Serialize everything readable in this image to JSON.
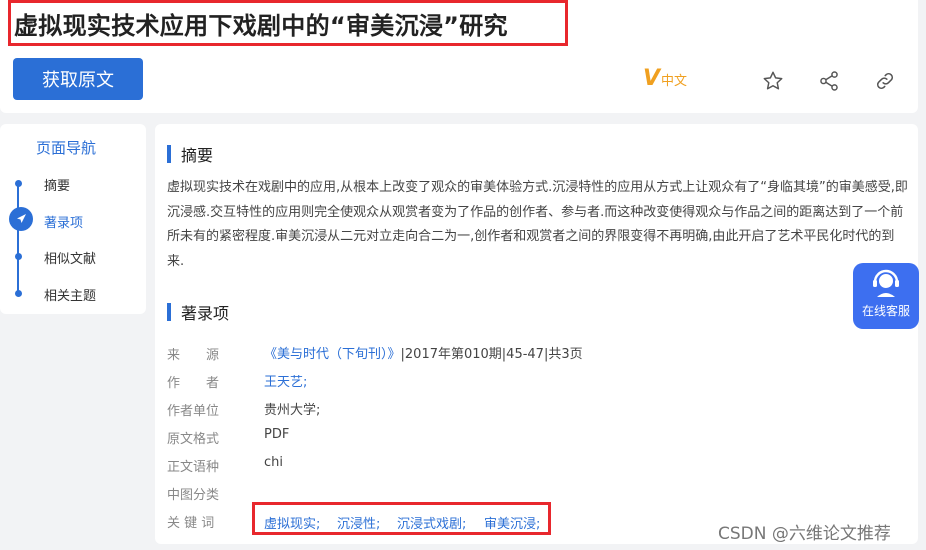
{
  "article": {
    "title": "虚拟现实技术应用下戏剧中的“审美沉浸”研究",
    "get_original_label": "获取原文",
    "vzh_logo_v": "V",
    "vzh_logo_text": "中文"
  },
  "toolbar_icons": [
    "star-icon",
    "share-icon",
    "link-icon"
  ],
  "nav": {
    "title": "页面导航",
    "items": [
      {
        "label": "摘要",
        "active": false
      },
      {
        "label": "著录项",
        "active": true
      },
      {
        "label": "相似文献",
        "active": false
      },
      {
        "label": "相关主题",
        "active": false
      }
    ]
  },
  "abstract": {
    "heading": "摘要",
    "text": "虚拟现实技术在戏剧中的应用,从根本上改变了观众的审美体验方式.沉浸特性的应用从方式上让观众有了“身临其境”的审美感受,即沉浸感.交互特性的应用则完全使观众从观赏者变为了作品的创作者、参与者.而这种改变使得观众与作品之间的距离达到了一个前所未有的紧密程度.审美沉浸从二元对立走向合二为一,创作者和观赏者之间的界限变得不再明确,由此开启了艺术平民化时代的到来."
  },
  "bibliography": {
    "heading": "著录项",
    "source_label": "来　　源",
    "source_link": "《美与时代（下旬刊）》",
    "source_detail": "|2017年第010期|45-47|共3页",
    "author_label": "作　　者",
    "author": "王天艺;",
    "affiliation_label": "作者单位",
    "affiliation": "贵州大学;",
    "format_label": "原文格式",
    "format": "PDF",
    "language_label": "正文语种",
    "language": "chi",
    "clc_label": "中图分类",
    "keywords_label": "关 键 词",
    "keywords": [
      "虚拟现实;",
      "沉浸性;",
      "沉浸式戏剧;",
      "审美沉浸;"
    ]
  },
  "service": {
    "label": "在线客服",
    "icon": "headset-icon"
  },
  "watermark": "CSDN @六维论文推荐",
  "colors": {
    "accent": "#2b6fd6",
    "highlight": "#e8272d",
    "logo": "#f0a020",
    "service": "#3d6ff0"
  }
}
